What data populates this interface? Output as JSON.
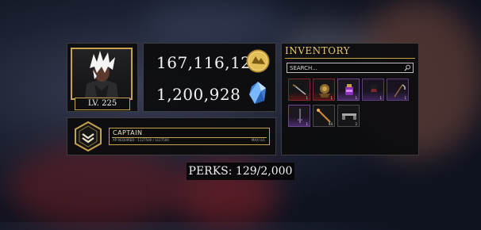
{
  "profile": {
    "level_label": "LV. 225"
  },
  "currencies": [
    {
      "value": "167,116,121",
      "icon": "gold-coin-icon",
      "color": "#d9b44a"
    },
    {
      "value": "1,200,928",
      "icon": "blue-crystal-icon",
      "color": "#6aa8ff"
    }
  ],
  "rank": {
    "name": "CAPTAIN",
    "xp_text": "XP REQUIRED - 1127500 / 1127500",
    "max_text": "MAX LVL",
    "icon": "rank-hexagon-icon"
  },
  "inventory": {
    "title": "INVENTORY",
    "search_placeholder": "SEARCH...",
    "slots": [
      {
        "icon": "blade-icon",
        "count": "1",
        "rarity": "red"
      },
      {
        "icon": "gear-armor-icon",
        "count": "1",
        "rarity": "red"
      },
      {
        "icon": "potion-jar-icon",
        "count": "1",
        "rarity": "purple"
      },
      {
        "icon": "cloak-icon",
        "count": "1",
        "rarity": "purple"
      },
      {
        "icon": "scythe-icon",
        "count": "1",
        "rarity": "purple"
      },
      {
        "icon": "thin-sword-icon",
        "count": "1",
        "rarity": "purple"
      },
      {
        "icon": "staff-icon",
        "count": "94",
        "rarity": "common"
      },
      {
        "icon": "gun-icon",
        "count": "2",
        "rarity": "common"
      }
    ]
  },
  "perks": {
    "label": "PERKS: 129/2,000"
  },
  "colors": {
    "accent_gold": "#c6a24e",
    "panel_bg": "#0c0c0e"
  }
}
